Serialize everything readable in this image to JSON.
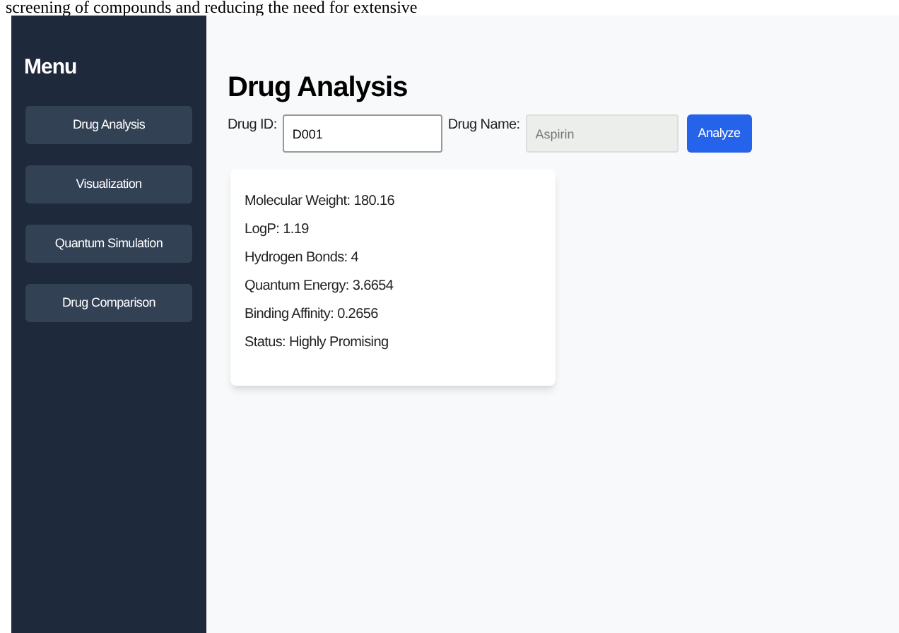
{
  "document_text": "screening of compounds and reducing the need for extensive",
  "sidebar": {
    "title": "Menu",
    "items": [
      {
        "label": "Drug Analysis"
      },
      {
        "label": "Visualization"
      },
      {
        "label": "Quantum Simulation"
      },
      {
        "label": "Drug Comparison"
      }
    ]
  },
  "main": {
    "title": "Drug Analysis",
    "fields": [
      {
        "label": "Drug ID:",
        "value": "D001",
        "disabled": false
      },
      {
        "label": "Drug Name:",
        "value": "Aspirin",
        "disabled": true
      }
    ],
    "button": "Analyze",
    "results": [
      "Molecular Weight: 180.16",
      "LogP: 1.19",
      "Hydrogen Bonds: 4",
      "Quantum Energy: 3.6654",
      "Binding Affinity: 0.2656",
      "Status: Highly Promising"
    ]
  }
}
